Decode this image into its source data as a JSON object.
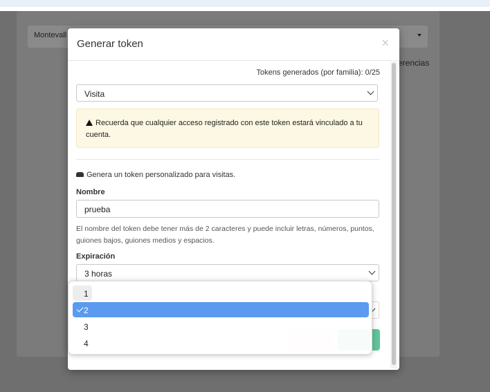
{
  "background": {
    "select_text": "Montevall",
    "link_text": "erencias"
  },
  "modal": {
    "title": "Generar token",
    "close_glyph": "×",
    "counter": "Tokens generados (por familia): 0/25",
    "type_select": "Visita",
    "alert_text": "Recuerda que cualquier acceso registrado con este token estará vinculado a tu cuenta.",
    "helper": "Genera un token personalizado para visitas.",
    "name_label": "Nombre",
    "name_value": "prueba",
    "name_help": "El nombre del token debe tener más de 2 caracteres y puede incluir letras, números, puntos, guiones bajos, guiones medios y espacios.",
    "expiration_label": "Expiración",
    "expiration_value": "3 horas"
  },
  "dropdown": {
    "options": [
      "1",
      "2",
      "3",
      "4"
    ],
    "selected": "2"
  },
  "icons": {
    "warning": "warning-triangle-icon",
    "car": "car-icon",
    "check": "checkmark-icon"
  }
}
